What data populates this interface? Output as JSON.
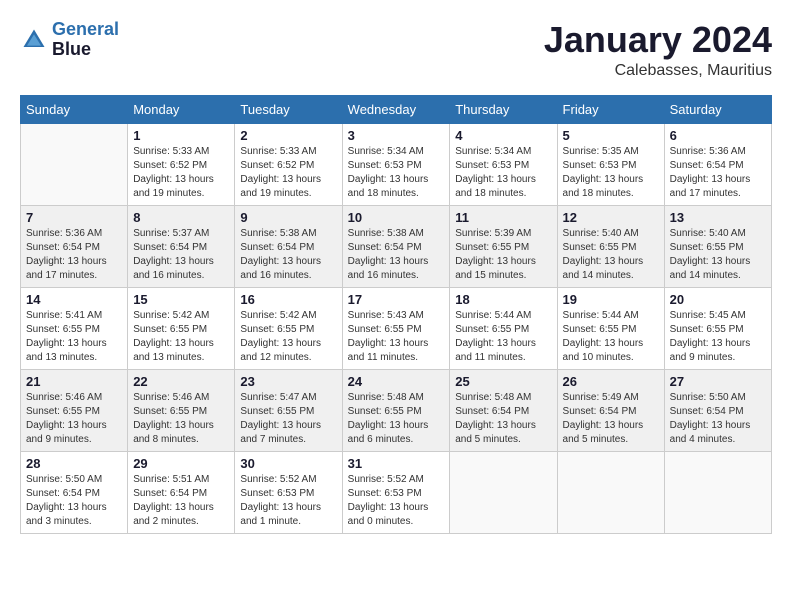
{
  "header": {
    "logo_line1": "General",
    "logo_line2": "Blue",
    "month_title": "January 2024",
    "location": "Calebasses, Mauritius"
  },
  "weekdays": [
    "Sunday",
    "Monday",
    "Tuesday",
    "Wednesday",
    "Thursday",
    "Friday",
    "Saturday"
  ],
  "weeks": [
    [
      {
        "day": "",
        "sunrise": "",
        "sunset": "",
        "daylight": ""
      },
      {
        "day": "1",
        "sunrise": "Sunrise: 5:33 AM",
        "sunset": "Sunset: 6:52 PM",
        "daylight": "Daylight: 13 hours and 19 minutes."
      },
      {
        "day": "2",
        "sunrise": "Sunrise: 5:33 AM",
        "sunset": "Sunset: 6:52 PM",
        "daylight": "Daylight: 13 hours and 19 minutes."
      },
      {
        "day": "3",
        "sunrise": "Sunrise: 5:34 AM",
        "sunset": "Sunset: 6:53 PM",
        "daylight": "Daylight: 13 hours and 18 minutes."
      },
      {
        "day": "4",
        "sunrise": "Sunrise: 5:34 AM",
        "sunset": "Sunset: 6:53 PM",
        "daylight": "Daylight: 13 hours and 18 minutes."
      },
      {
        "day": "5",
        "sunrise": "Sunrise: 5:35 AM",
        "sunset": "Sunset: 6:53 PM",
        "daylight": "Daylight: 13 hours and 18 minutes."
      },
      {
        "day": "6",
        "sunrise": "Sunrise: 5:36 AM",
        "sunset": "Sunset: 6:54 PM",
        "daylight": "Daylight: 13 hours and 17 minutes."
      }
    ],
    [
      {
        "day": "7",
        "sunrise": "Sunrise: 5:36 AM",
        "sunset": "Sunset: 6:54 PM",
        "daylight": "Daylight: 13 hours and 17 minutes."
      },
      {
        "day": "8",
        "sunrise": "Sunrise: 5:37 AM",
        "sunset": "Sunset: 6:54 PM",
        "daylight": "Daylight: 13 hours and 16 minutes."
      },
      {
        "day": "9",
        "sunrise": "Sunrise: 5:38 AM",
        "sunset": "Sunset: 6:54 PM",
        "daylight": "Daylight: 13 hours and 16 minutes."
      },
      {
        "day": "10",
        "sunrise": "Sunrise: 5:38 AM",
        "sunset": "Sunset: 6:54 PM",
        "daylight": "Daylight: 13 hours and 16 minutes."
      },
      {
        "day": "11",
        "sunrise": "Sunrise: 5:39 AM",
        "sunset": "Sunset: 6:55 PM",
        "daylight": "Daylight: 13 hours and 15 minutes."
      },
      {
        "day": "12",
        "sunrise": "Sunrise: 5:40 AM",
        "sunset": "Sunset: 6:55 PM",
        "daylight": "Daylight: 13 hours and 14 minutes."
      },
      {
        "day": "13",
        "sunrise": "Sunrise: 5:40 AM",
        "sunset": "Sunset: 6:55 PM",
        "daylight": "Daylight: 13 hours and 14 minutes."
      }
    ],
    [
      {
        "day": "14",
        "sunrise": "Sunrise: 5:41 AM",
        "sunset": "Sunset: 6:55 PM",
        "daylight": "Daylight: 13 hours and 13 minutes."
      },
      {
        "day": "15",
        "sunrise": "Sunrise: 5:42 AM",
        "sunset": "Sunset: 6:55 PM",
        "daylight": "Daylight: 13 hours and 13 minutes."
      },
      {
        "day": "16",
        "sunrise": "Sunrise: 5:42 AM",
        "sunset": "Sunset: 6:55 PM",
        "daylight": "Daylight: 13 hours and 12 minutes."
      },
      {
        "day": "17",
        "sunrise": "Sunrise: 5:43 AM",
        "sunset": "Sunset: 6:55 PM",
        "daylight": "Daylight: 13 hours and 11 minutes."
      },
      {
        "day": "18",
        "sunrise": "Sunrise: 5:44 AM",
        "sunset": "Sunset: 6:55 PM",
        "daylight": "Daylight: 13 hours and 11 minutes."
      },
      {
        "day": "19",
        "sunrise": "Sunrise: 5:44 AM",
        "sunset": "Sunset: 6:55 PM",
        "daylight": "Daylight: 13 hours and 10 minutes."
      },
      {
        "day": "20",
        "sunrise": "Sunrise: 5:45 AM",
        "sunset": "Sunset: 6:55 PM",
        "daylight": "Daylight: 13 hours and 9 minutes."
      }
    ],
    [
      {
        "day": "21",
        "sunrise": "Sunrise: 5:46 AM",
        "sunset": "Sunset: 6:55 PM",
        "daylight": "Daylight: 13 hours and 9 minutes."
      },
      {
        "day": "22",
        "sunrise": "Sunrise: 5:46 AM",
        "sunset": "Sunset: 6:55 PM",
        "daylight": "Daylight: 13 hours and 8 minutes."
      },
      {
        "day": "23",
        "sunrise": "Sunrise: 5:47 AM",
        "sunset": "Sunset: 6:55 PM",
        "daylight": "Daylight: 13 hours and 7 minutes."
      },
      {
        "day": "24",
        "sunrise": "Sunrise: 5:48 AM",
        "sunset": "Sunset: 6:55 PM",
        "daylight": "Daylight: 13 hours and 6 minutes."
      },
      {
        "day": "25",
        "sunrise": "Sunrise: 5:48 AM",
        "sunset": "Sunset: 6:54 PM",
        "daylight": "Daylight: 13 hours and 5 minutes."
      },
      {
        "day": "26",
        "sunrise": "Sunrise: 5:49 AM",
        "sunset": "Sunset: 6:54 PM",
        "daylight": "Daylight: 13 hours and 5 minutes."
      },
      {
        "day": "27",
        "sunrise": "Sunrise: 5:50 AM",
        "sunset": "Sunset: 6:54 PM",
        "daylight": "Daylight: 13 hours and 4 minutes."
      }
    ],
    [
      {
        "day": "28",
        "sunrise": "Sunrise: 5:50 AM",
        "sunset": "Sunset: 6:54 PM",
        "daylight": "Daylight: 13 hours and 3 minutes."
      },
      {
        "day": "29",
        "sunrise": "Sunrise: 5:51 AM",
        "sunset": "Sunset: 6:54 PM",
        "daylight": "Daylight: 13 hours and 2 minutes."
      },
      {
        "day": "30",
        "sunrise": "Sunrise: 5:52 AM",
        "sunset": "Sunset: 6:53 PM",
        "daylight": "Daylight: 13 hours and 1 minute."
      },
      {
        "day": "31",
        "sunrise": "Sunrise: 5:52 AM",
        "sunset": "Sunset: 6:53 PM",
        "daylight": "Daylight: 13 hours and 0 minutes."
      },
      {
        "day": "",
        "sunrise": "",
        "sunset": "",
        "daylight": ""
      },
      {
        "day": "",
        "sunrise": "",
        "sunset": "",
        "daylight": ""
      },
      {
        "day": "",
        "sunrise": "",
        "sunset": "",
        "daylight": ""
      }
    ]
  ]
}
